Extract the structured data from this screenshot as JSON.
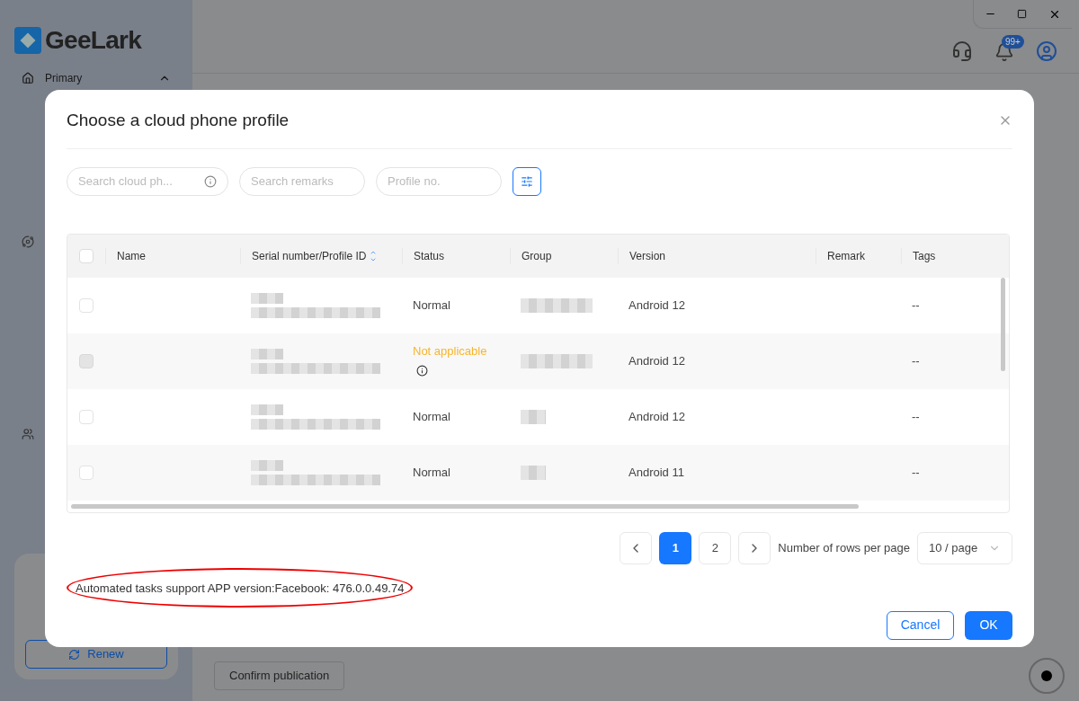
{
  "app": {
    "logo": "GeeLark",
    "sidebar_item": "Primary",
    "renew_button": "Renew",
    "confirm_button": "Confirm publication",
    "notification_badge": "99+"
  },
  "dialog": {
    "title": "Choose a cloud phone profile",
    "search_fields": [
      {
        "placeholder": "Search cloud ph...",
        "info": true
      },
      {
        "placeholder": "Search remarks",
        "info": false
      },
      {
        "placeholder": "Profile no.",
        "info": false
      }
    ],
    "header_checkbox": {
      "checked": false
    },
    "columns": [
      "Name",
      "Serial number/Profile ID",
      "Status",
      "Group",
      "Version",
      "Remark",
      "Tags"
    ],
    "rows": [
      {
        "disabled": false,
        "status": "Normal",
        "kind": "normal",
        "version": "Android 12",
        "tags": "--"
      },
      {
        "disabled": true,
        "status": "Not applicable",
        "kind": "warning",
        "version": "Android 12",
        "tags": "--"
      },
      {
        "disabled": false,
        "status": "Normal",
        "kind": "normal",
        "version": "Android 12",
        "tags": "--"
      },
      {
        "disabled": false,
        "status": "Normal",
        "kind": "normal",
        "version": "Android 11",
        "tags": "--"
      }
    ],
    "pages": [
      {
        "label": "1",
        "selected": true
      },
      {
        "label": "2",
        "selected": false
      }
    ],
    "rows_per_page_label": "Number of rows per page",
    "page_size": "10 / page",
    "note": "Automated tasks support APP version:Facebook: 476.0.0.49.74",
    "cancel": "Cancel",
    "ok": "OK"
  }
}
